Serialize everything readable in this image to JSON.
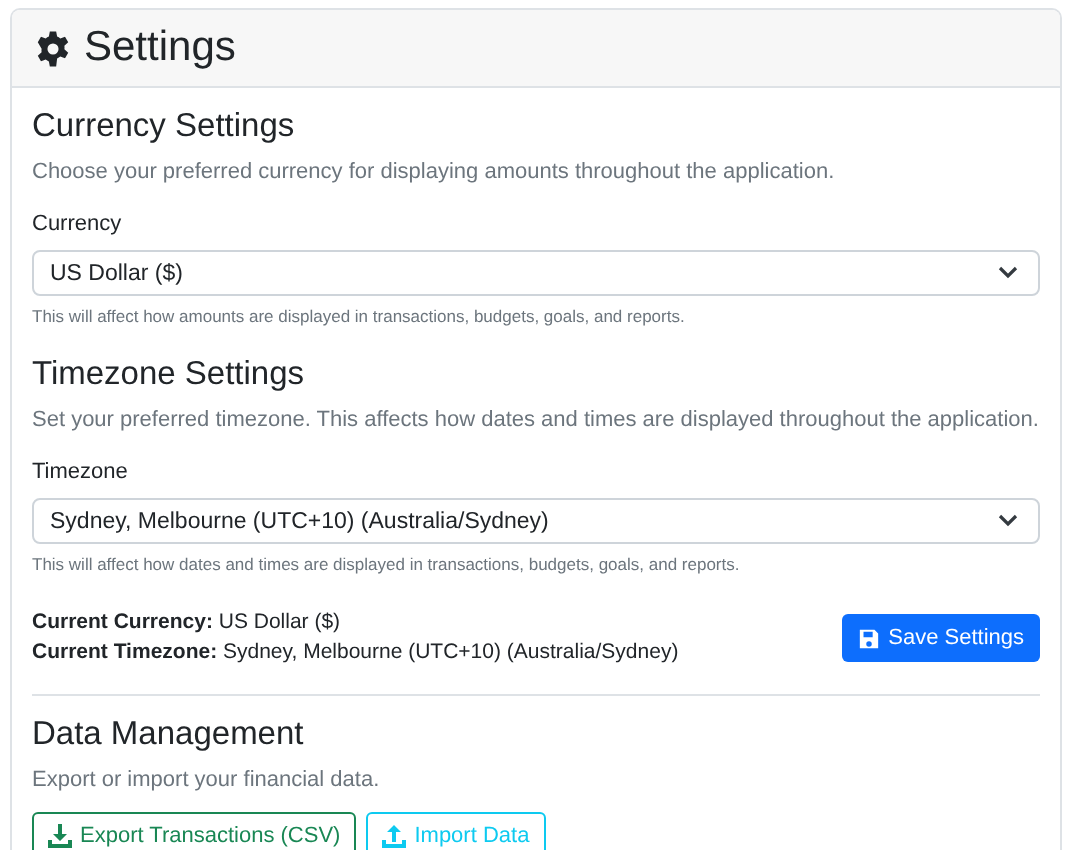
{
  "header": {
    "title": "Settings"
  },
  "sections": [
    {
      "heading": "Currency Settings",
      "description": "Choose your preferred currency for displaying amounts throughout the application.",
      "field_label": "Currency",
      "value": "US Dollar ($)",
      "help": "This will affect how amounts are displayed in transactions, budgets, goals, and reports."
    },
    {
      "heading": "Timezone Settings",
      "description": "Set your preferred timezone. This affects how dates and times are displayed throughout the application.",
      "field_label": "Timezone",
      "value": "Sydney, Melbourne (UTC+10) (Australia/Sydney)",
      "help": "This will affect how dates and times are displayed in transactions, budgets, goals, and reports."
    }
  ],
  "summary": [
    "**Current Currency:** US Dollar ($)",
    "**Current Timezone:** Sydney, Melbourne (UTC+10) (Australia/Sydney)"
  ],
  "save_button": "Save Settings",
  "data_management": {
    "heading": "Data Management",
    "description": "Export or import your financial data.",
    "buttons": [
      {
        "label": "Export Transactions (CSV)",
        "kind": "export"
      },
      {
        "label": "Import Data",
        "kind": "import"
      }
    ]
  }
}
